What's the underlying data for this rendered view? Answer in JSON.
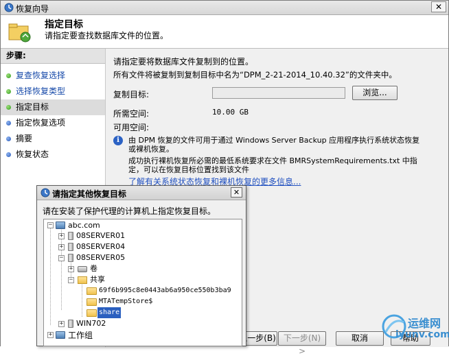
{
  "window": {
    "title": "恢复向导",
    "close_glyph": "✕"
  },
  "header": {
    "title": "指定目标",
    "subtitle": "请指定要查找数据库文件的位置。"
  },
  "steps": {
    "heading": "步骤:",
    "items": [
      {
        "label": "复查恢复选择",
        "state": "done"
      },
      {
        "label": "选择恢复类型",
        "state": "done"
      },
      {
        "label": "指定目标",
        "state": "current"
      },
      {
        "label": "指定恢复选项",
        "state": "pending"
      },
      {
        "label": "摘要",
        "state": "pending"
      },
      {
        "label": "恢复状态",
        "state": "pending"
      }
    ]
  },
  "content": {
    "intro1": "请指定要将数据库文件复制到的位置。",
    "intro2": "所有文件将被复制到复制目标中名为“DPM_2-21-2014_10.40.32”的文件夹中。",
    "copy_target_label": "复制目标:",
    "copy_target_value": "",
    "browse_label": "浏览...",
    "required_space_label": "所需空间:",
    "required_space_value": "10.00 GB",
    "available_space_label": "可用空间:",
    "info_line1": "由 DPM 恢复的文件可用于通过 Windows Server Backup 应用程序执行系统状态恢复",
    "info_line2": "或裸机恢复。",
    "info_line3": "成功执行裸机恢复所必需的最低系统要求在文件 BMRSystemRequirements.txt 中指",
    "info_line4": "定，可以在恢复目标位置找到该文件",
    "learn_link": "了解有关系统状态恢复和裸机恢复的更多信息..."
  },
  "footer": {
    "back_label": "上一步(B)",
    "next_label": "下一步(N) >",
    "cancel_label": "取消",
    "help_label": "帮助"
  },
  "dialog": {
    "title": "请指定其他恢复目标",
    "close_glyph": "✕",
    "prompt": "请在安装了保护代理的计算机上指定恢复目标。",
    "tree": {
      "root": "abc.com",
      "server1": "08SERVER01",
      "server2": "08SERVER04",
      "server3": "08SERVER05",
      "volumes": "卷",
      "shares": "共享",
      "share1": "69f6b995c8e0443ab6a950ce550b3ba9",
      "share2": "MTATempStore$",
      "share3": "share",
      "server4": "WIN702",
      "workgroup": "工作组"
    }
  },
  "watermark": {
    "title": "运维网",
    "url": "iyunv.com"
  },
  "colors": {
    "selection": "#2a5fbf",
    "link": "#1f4fbf",
    "done_step": "#1548a8"
  }
}
